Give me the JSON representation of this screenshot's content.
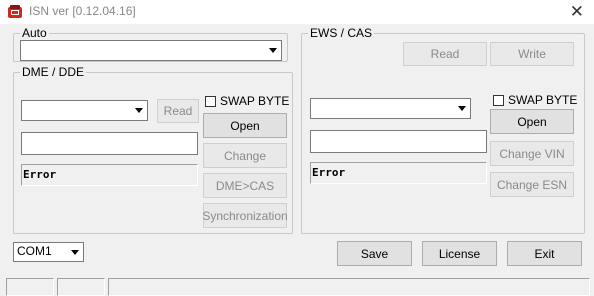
{
  "window": {
    "title": "ISN ver [0.12.04.16]"
  },
  "auto": {
    "label": "Auto",
    "value": ""
  },
  "dme": {
    "label": "DME / DDE",
    "combo_value": "",
    "read_label": "Read",
    "swap_label": "SWAP BYTE",
    "open_label": "Open",
    "change_label": "Change",
    "dmecas_label": "DME>CAS",
    "sync_label": "Synchronization",
    "error_text": "Error"
  },
  "ews": {
    "label": "EWS / CAS",
    "read_label": "Read",
    "write_label": "Write",
    "combo_value": "",
    "swap_label": "SWAP BYTE",
    "open_label": "Open",
    "change_vin_label": "Change VIN",
    "change_esn_label": "Change ESN",
    "error_text": "Error"
  },
  "bottom": {
    "com_value": "COM1",
    "save_label": "Save",
    "license_label": "License",
    "exit_label": "Exit"
  },
  "icons": {
    "app": "app-icon",
    "close": "close-icon",
    "dropdown": "chevron-down-icon"
  }
}
